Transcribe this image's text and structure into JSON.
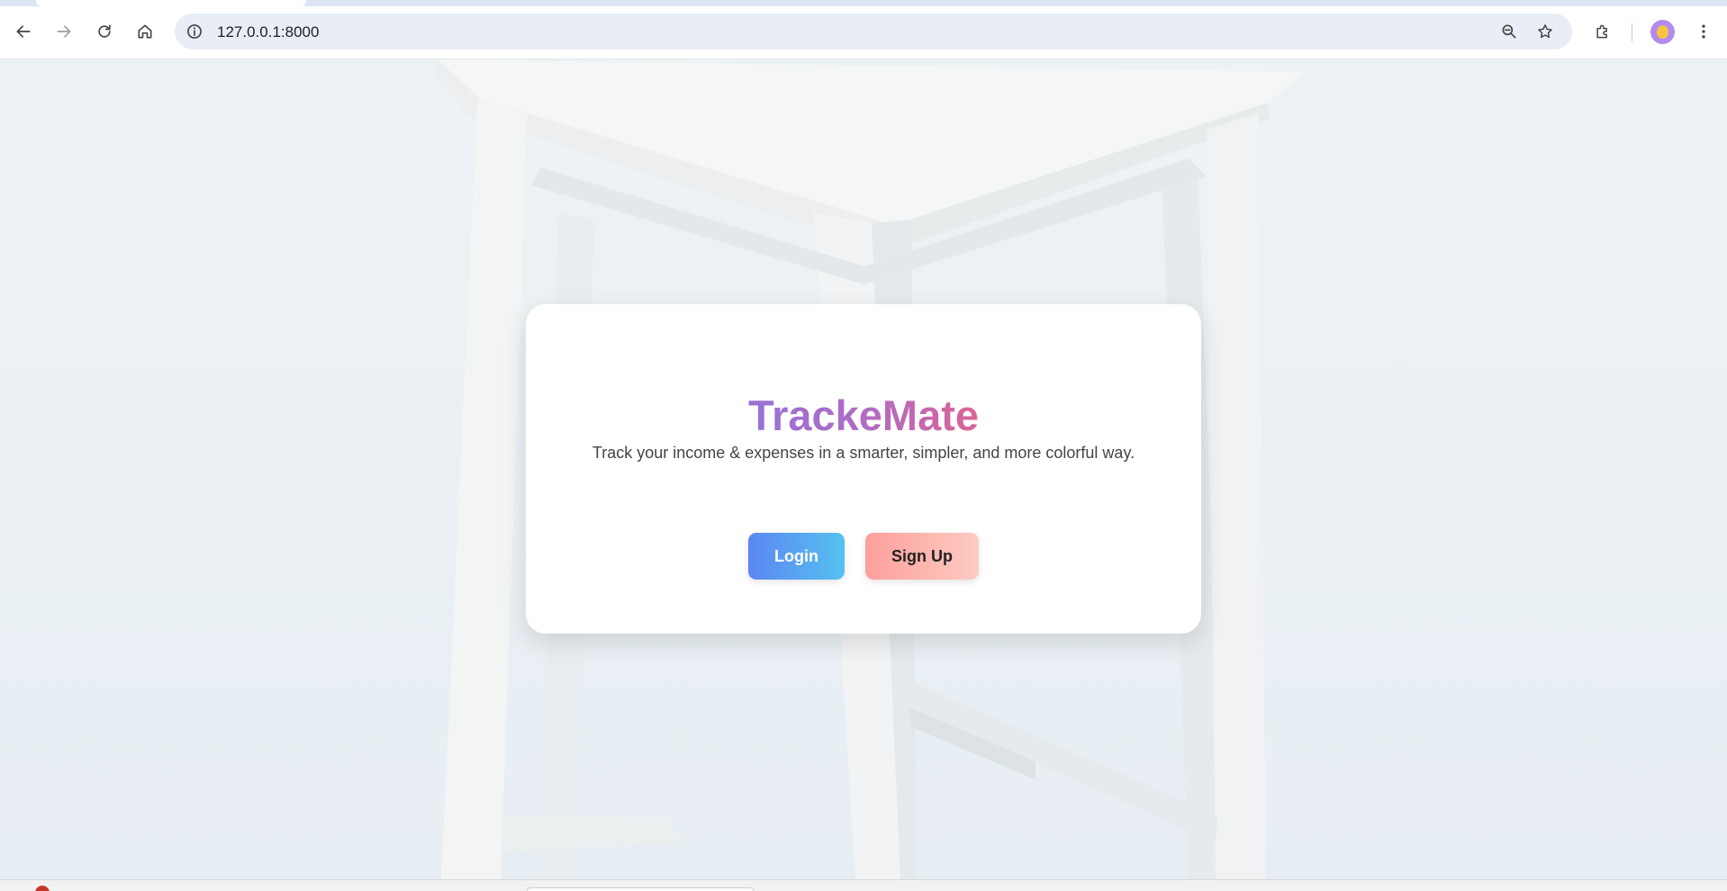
{
  "browser": {
    "url": "127.0.0.1:8000",
    "icons": {
      "back": "arrow-left-icon",
      "forward": "arrow-right-icon",
      "reload": "reload-icon",
      "home": "home-icon",
      "site_info": "info-icon",
      "zoom": "zoom-out-icon",
      "bookmark": "star-icon",
      "extensions": "puzzle-icon",
      "profile": "avatar-icon",
      "menu": "kebab-menu-icon"
    }
  },
  "landing": {
    "title": "TrackeMate",
    "tagline": "Track your income & expenses in a smarter, simpler, and more colorful way.",
    "login_label": "Login",
    "signup_label": "Sign Up"
  },
  "colors": {
    "brand_gradient_start": "#9674d6",
    "brand_gradient_end": "#db6497",
    "login_gradient_start": "#5d86f3",
    "login_gradient_end": "#55c1ef",
    "signup_gradient_start": "#fd9f9c",
    "signup_gradient_end": "#fdcbc2"
  }
}
